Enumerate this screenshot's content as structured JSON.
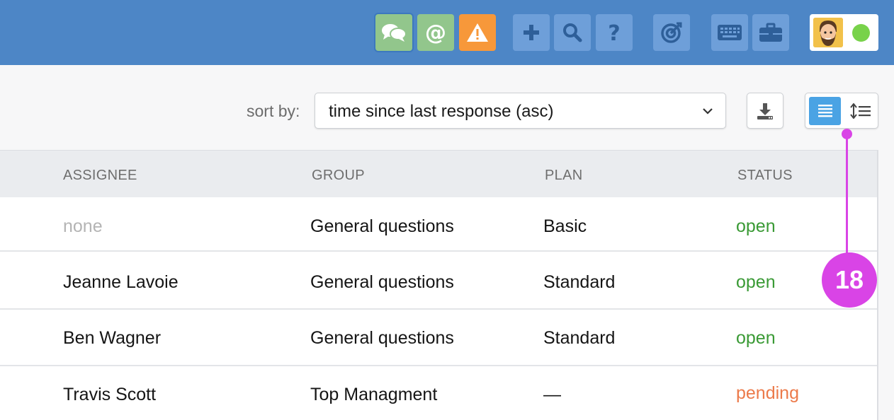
{
  "topbar": {
    "buttons": [
      {
        "icon": "chat-icon",
        "color": "#92c68c"
      },
      {
        "icon": "at-sign-icon",
        "color": "#92c68c"
      },
      {
        "icon": "warning-icon",
        "color": "#f7983a"
      },
      {
        "icon": "plus-icon",
        "color": "#6e9fd9"
      },
      {
        "icon": "search-icon",
        "color": "#6e9fd9"
      },
      {
        "icon": "help-icon",
        "color": "#6e9fd9"
      },
      {
        "icon": "target-icon",
        "color": "#6e9fd9"
      },
      {
        "icon": "keyboard-icon",
        "color": "#6e9fd9"
      },
      {
        "icon": "briefcase-icon",
        "color": "#6e9fd9"
      }
    ],
    "profile": {
      "avatar_icon": "avatar-icon",
      "status": "online",
      "status_color": "#78d24a"
    }
  },
  "toolbar": {
    "sort_label": "sort by:",
    "sort_value": "time since last response (asc)",
    "download_icon": "download-icon",
    "view_modes": [
      "list-view-icon",
      "compact-view-icon"
    ],
    "active_view": "list-view-icon"
  },
  "table": {
    "columns": [
      "ASSIGNEE",
      "GROUP",
      "PLAN",
      "STATUS"
    ],
    "rows": [
      {
        "assignee": "none",
        "group": "General questions",
        "plan": "Basic",
        "status": "open"
      },
      {
        "assignee": "Jeanne Lavoie",
        "group": "General questions",
        "plan": "Standard",
        "status": "open"
      },
      {
        "assignee": "Ben Wagner",
        "group": "General questions",
        "plan": "Standard",
        "status": "open"
      },
      {
        "assignee": "Travis Scott",
        "group": "Top Managment",
        "plan": "—",
        "status": "pending"
      }
    ]
  },
  "callout": {
    "number": "18",
    "color": "#d944e6"
  }
}
